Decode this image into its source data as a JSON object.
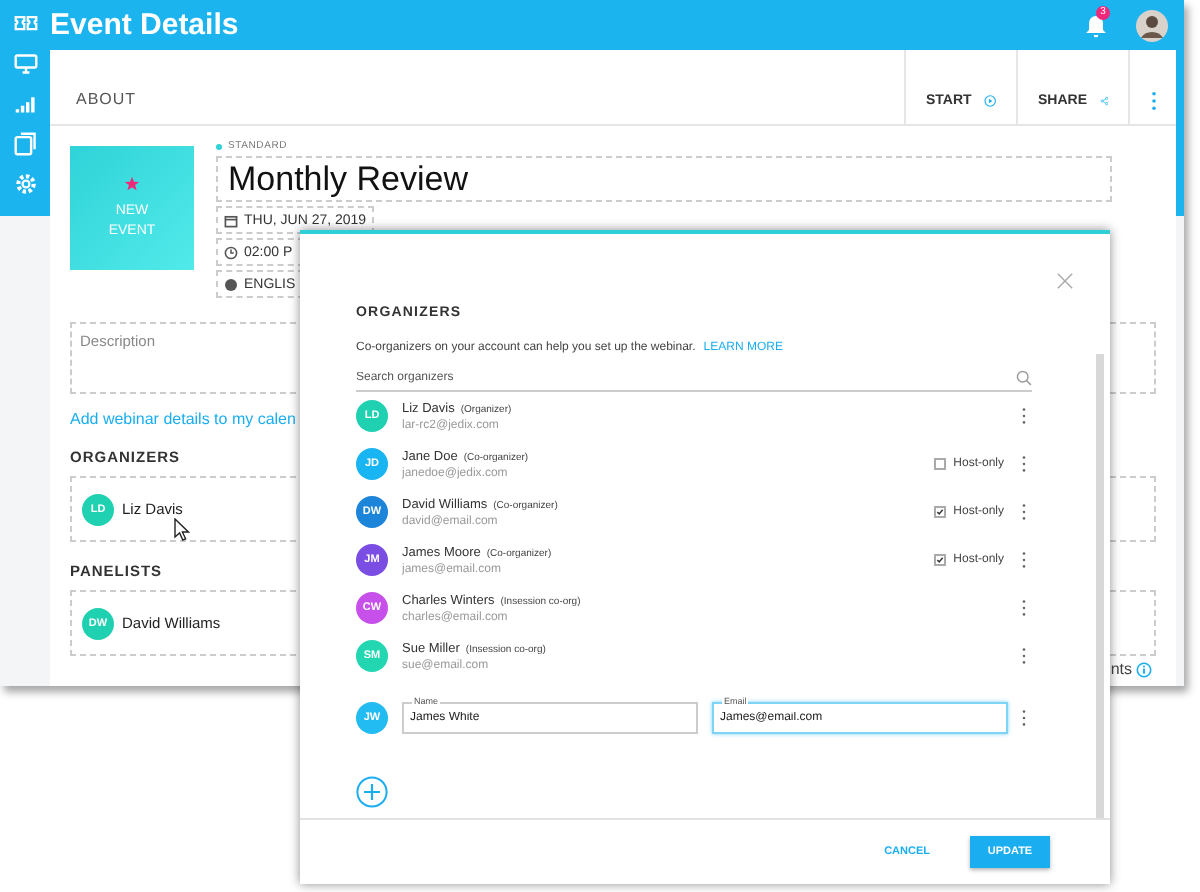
{
  "header": {
    "title": "Event Details",
    "notification_count": "3"
  },
  "card": {
    "section_title": "ABOUT",
    "actions": [
      {
        "label": "START"
      },
      {
        "label": "SHARE"
      }
    ],
    "tile": {
      "label": "NEW EVENT"
    },
    "event_type": "STANDARD",
    "title": "Monthly Review",
    "chips": [
      {
        "kind": "date",
        "text": "THU, JUN 27, 2019"
      },
      {
        "kind": "time",
        "text": "02:00 P"
      },
      {
        "kind": "language",
        "text": "ENGLIS"
      }
    ],
    "description_placeholder": "Description",
    "calendar_link": "Add webinar details to my calen",
    "groups": [
      {
        "title": "ORGANIZERS",
        "people": [
          {
            "initials": "LD",
            "name": "Liz Davis",
            "color": "#1fd1b0"
          }
        ]
      },
      {
        "title": "PANELISTS",
        "people": [
          {
            "initials": "DW",
            "name": "David Williams",
            "color": "#1fd1b0"
          }
        ]
      }
    ],
    "footer_text": "nts"
  },
  "dialog": {
    "title": "ORGANIZERS",
    "intro": "Co-organizers on your account can help you set up the webinar.",
    "learn_more": "LEARN MORE",
    "search_placeholder": "Search organizers",
    "organizers": [
      {
        "initials": "LD",
        "color": "#1fd1b0",
        "name": "Liz Davis",
        "role": "(Organizer)",
        "email": "lar-rc2@jedix.com"
      },
      {
        "initials": "JD",
        "color": "#19b5f2",
        "name": "Jane Doe",
        "role": "(Co-organizer)",
        "email": "janedoe@jedix.com",
        "host_only": false,
        "host_label": "Host-only"
      },
      {
        "initials": "DW",
        "color": "#1c84d9",
        "name": "David Williams",
        "role": "(Co-organizer)",
        "email": "david@email.com",
        "host_only": true,
        "host_label": "Host-only"
      },
      {
        "initials": "JM",
        "color": "#7a4ee3",
        "name": "James Moore",
        "role": "(Co-organizer)",
        "email": "james@email.com",
        "host_only": true,
        "host_label": "Host-only"
      },
      {
        "initials": "CW",
        "color": "#c850ea",
        "name": "Charles Winters",
        "role": "(Insession co-org)",
        "email": "charles@email.com"
      },
      {
        "initials": "SM",
        "color": "#23d6b2",
        "name": "Sue Miller",
        "role": "(Insession co-org)",
        "email": "sue@email.com"
      }
    ],
    "new_entry": {
      "initials": "JW",
      "color": "#22bcf2",
      "name_label": "Name",
      "name_value": "James White",
      "email_label": "Email",
      "email_value": "James@email.com"
    },
    "buttons": [
      {
        "kind": "cancel",
        "label": "CANCEL"
      },
      {
        "kind": "primary",
        "label": "UPDATE"
      }
    ]
  }
}
